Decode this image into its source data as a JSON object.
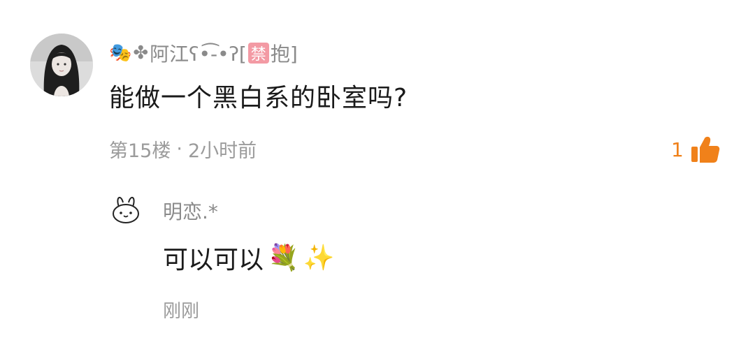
{
  "comment": {
    "username_emoji_1": "🎭",
    "username_emoji_2": "✤",
    "username_text": "阿江ʕ•͡-•ʔ[",
    "username_ban_badge": "禁",
    "username_suffix": "抱]",
    "text": "能做一个黑白系的卧室吗?",
    "floor": "第15楼",
    "separator": "·",
    "time": "2小时前",
    "like_count": "1",
    "accent_color": "#f0811a"
  },
  "reply": {
    "username": "明恋.*",
    "text": "可以可以",
    "emoji_1": "💐",
    "emoji_2": "✨",
    "time": "刚刚"
  }
}
